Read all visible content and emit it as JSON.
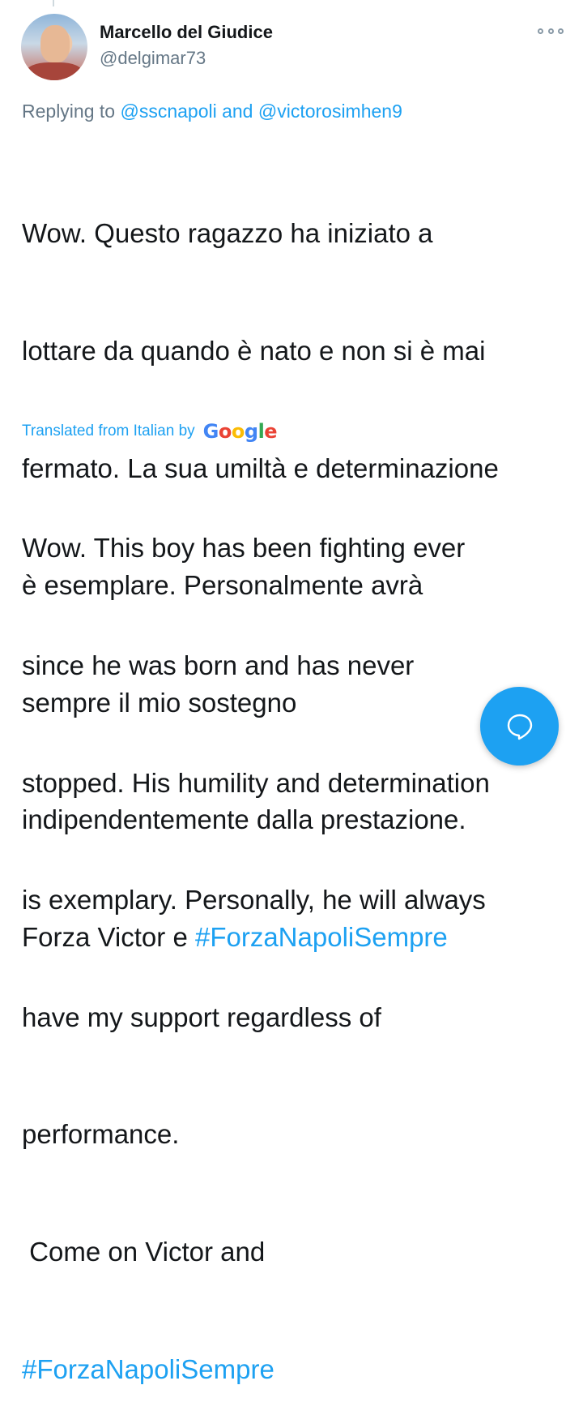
{
  "author": {
    "name": "Marcello del Giudice",
    "handle": "@delgimar73"
  },
  "reply": {
    "prefix": "Replying to",
    "user1": "@sscnapoli",
    "and": "and",
    "user2": "@victorosimhen9"
  },
  "tweet": {
    "original_lines": [
      "Wow. Questo ragazzo ha iniziato a",
      "lottare da quando è nato e non si è mai",
      "fermato. La sua umiltà e determinazione",
      "è esemplare. Personalmente avrà",
      "sempre il mio sostegno",
      "indipendentemente dalla prestazione."
    ],
    "original_last_prefix": "Forza Victor e ",
    "original_hashtag": "#ForzaNapoliSempre",
    "translated_label": "Translated from Italian by",
    "translator_logo": "Google",
    "translated_lines": [
      "Wow. This boy has been fighting ever",
      "since he was born and has never",
      "stopped. His humility and determination",
      "is exemplary. Personally, he will always",
      "have my support regardless of",
      "performance.",
      " Come on Victor and"
    ],
    "translated_hashtag": "#ForzaNapoliSempre"
  },
  "icons": {
    "more": "more-options-icon",
    "compose": "compose-reply-icon"
  },
  "colors": {
    "accent": "#1da1f2",
    "text": "#14171a",
    "muted": "#657786"
  }
}
